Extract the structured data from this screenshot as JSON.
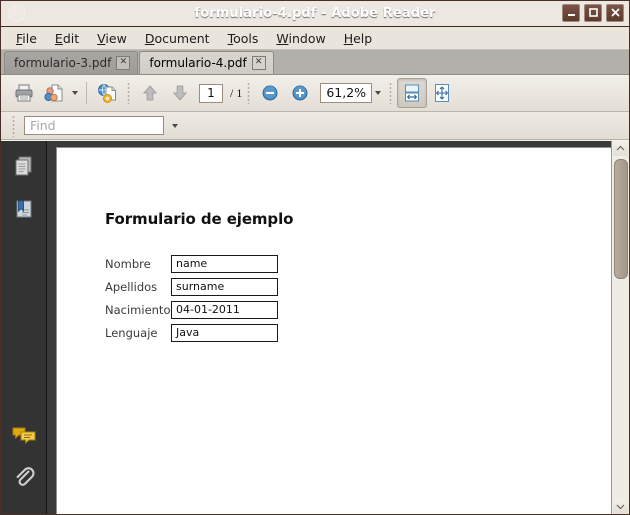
{
  "window": {
    "title": "formulario-4.pdf - Adobe Reader",
    "app_icon": "document-circle-icon",
    "controls": {
      "minimize": "_",
      "maximize": "□",
      "close": "✕"
    }
  },
  "menubar": {
    "items": [
      {
        "label": "File",
        "mnemonic": "F"
      },
      {
        "label": "Edit",
        "mnemonic": "E"
      },
      {
        "label": "View",
        "mnemonic": "V"
      },
      {
        "label": "Document",
        "mnemonic": "D"
      },
      {
        "label": "Tools",
        "mnemonic": "T"
      },
      {
        "label": "Window",
        "mnemonic": "W"
      },
      {
        "label": "Help",
        "mnemonic": "H"
      }
    ]
  },
  "tabs": [
    {
      "label": "formulario-3.pdf",
      "close": "✕",
      "active": false
    },
    {
      "label": "formulario-4.pdf",
      "close": "✕",
      "active": true
    }
  ],
  "toolbar": {
    "print": "print-icon",
    "share": "share-document-icon",
    "share_dropdown": "chevron-down-icon",
    "web_tools": "globe-document-icon",
    "previous_page": "arrow-up-icon",
    "next_page": "arrow-down-icon",
    "page_number": "1",
    "page_separator": "/",
    "page_total": "1",
    "zoom_out": "minus-circle-icon",
    "zoom_in": "plus-circle-icon",
    "zoom_value": "61,2%",
    "zoom_dropdown": "chevron-down-icon",
    "fit_width": "fit-width-icon",
    "fit_page": "fit-page-icon"
  },
  "findbar": {
    "placeholder": "Find",
    "value": "",
    "dropdown": "chevron-down-icon"
  },
  "navpanel": {
    "items": [
      {
        "name": "pages-icon",
        "label": "Pages"
      },
      {
        "name": "bookmarks-icon",
        "label": "Bookmarks"
      },
      {
        "name": "comments-icon",
        "label": "Comments"
      },
      {
        "name": "attachments-icon",
        "label": "Attachments"
      }
    ]
  },
  "document": {
    "heading": "Formulario de ejemplo",
    "fields": [
      {
        "label": "Nombre",
        "value": "name"
      },
      {
        "label": "Apellidos",
        "value": "surname"
      },
      {
        "label": "Nacimiento",
        "value": "04-01-2011"
      },
      {
        "label": "Lenguaje",
        "value": "Java"
      }
    ]
  },
  "scrollbar": {
    "up": "chevron-up-icon",
    "down": "chevron-down-icon"
  },
  "colors": {
    "titlebar": "#6d4638",
    "menubar": "#e9e4dc",
    "tabbar": "#b2b0ab",
    "navpanel": "#333333",
    "page": "#ffffff",
    "accent_blue": "#3a7cb8"
  }
}
